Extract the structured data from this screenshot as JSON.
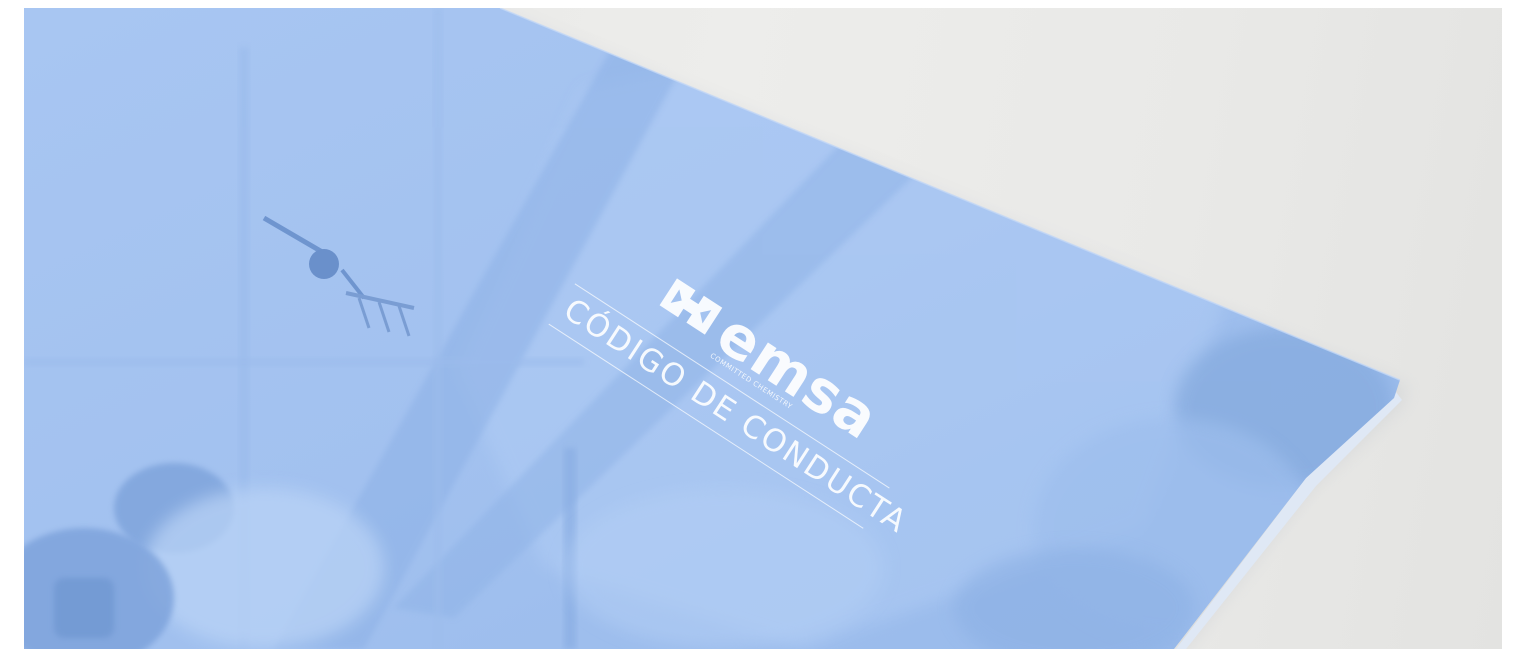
{
  "scene": {
    "description_type": "photo of a printed brochure cover on a light surface",
    "background_color": "#e8e8e6",
    "cover_color": "#a4c3f0",
    "cover_tint_color": "#8fb3e6"
  },
  "brochure": {
    "brand_name": "emsa",
    "brand_tagline": "COMMITTED CHEMISTRY",
    "title": "CÓDIGO DE CONDUCTA",
    "logo_icon": "emsa-logo-mark-icon",
    "text_color": "#ffffff"
  }
}
